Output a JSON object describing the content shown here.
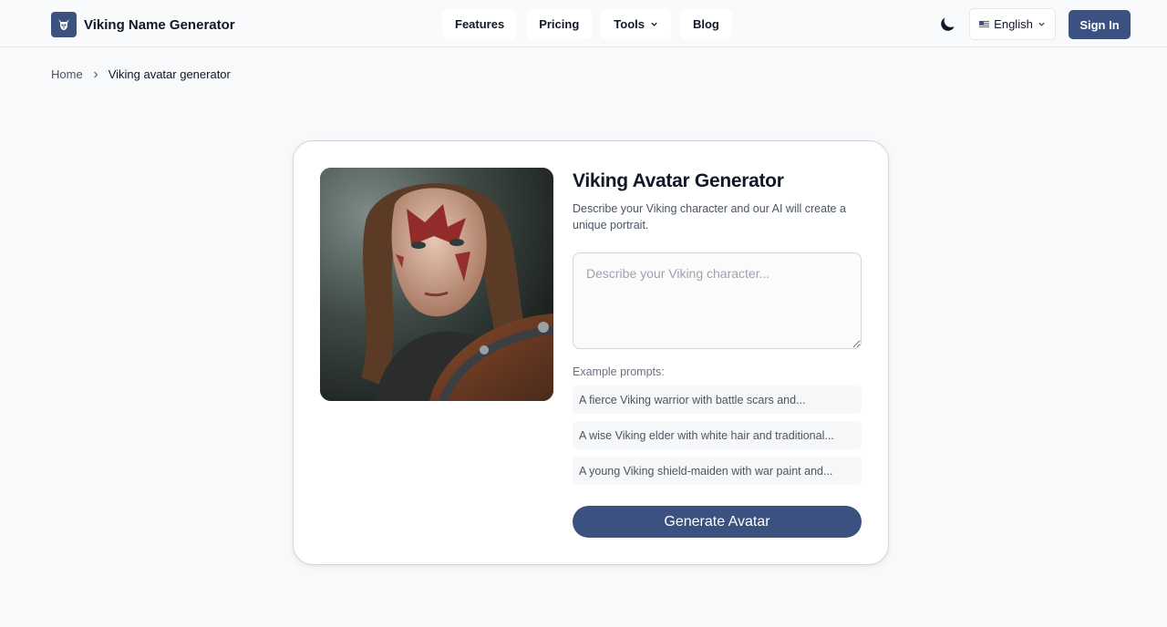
{
  "header": {
    "brand": "Viking Name Generator",
    "nav": [
      {
        "label": "Features"
      },
      {
        "label": "Pricing"
      },
      {
        "label": "Tools"
      },
      {
        "label": "Blog"
      }
    ],
    "language": "English",
    "sign_in": "Sign In"
  },
  "breadcrumb": {
    "home": "Home",
    "current": "Viking avatar generator"
  },
  "card": {
    "title": "Viking Avatar Generator",
    "subtitle": "Describe your Viking character and our AI will create a unique portrait.",
    "input_value": "",
    "input_placeholder": "Describe your Viking character...",
    "examples_label": "Example prompts:",
    "examples": [
      "A fierce Viking warrior with battle scars and...",
      "A wise Viking elder with white hair and traditional...",
      "A young Viking shield-maiden with war paint and..."
    ],
    "generate_label": "Generate Avatar"
  },
  "colors": {
    "accent": "#3b5180",
    "background": "#f7f9fb",
    "card": "#ffffff"
  },
  "icons": [
    "viking-helmet-icon",
    "chevron-down-icon",
    "moon-icon",
    "us-flag-icon",
    "chevron-right-icon"
  ]
}
